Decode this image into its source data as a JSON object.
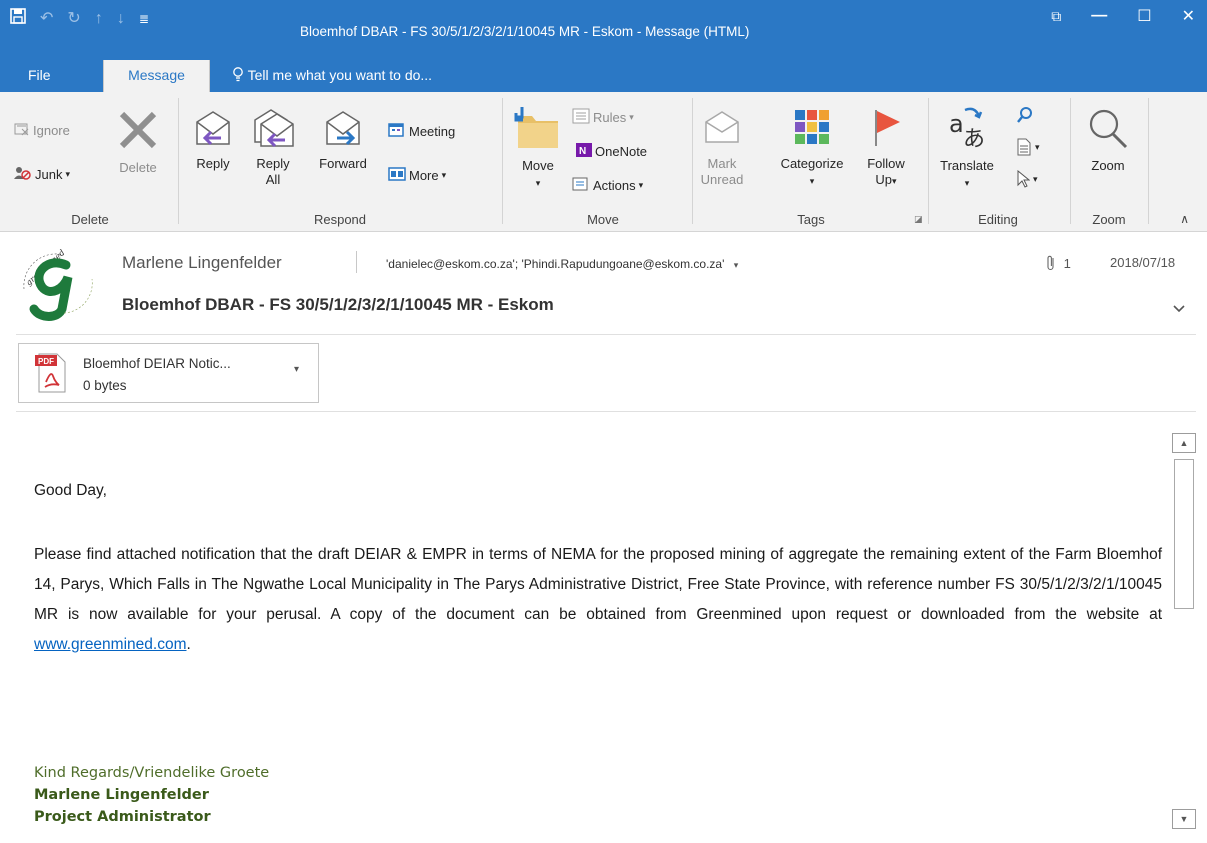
{
  "window": {
    "title": "Bloemhof DBAR - FS 30/5/1/2/3/2/1/10045 MR - Eskom - Message (HTML)",
    "minimize": "—",
    "maximize": "☐",
    "close": "✕",
    "restore_ribbon": "⧉"
  },
  "qat": {
    "save": "💾",
    "undo": "↶",
    "redo": "↻",
    "up": "↑",
    "down": "↓",
    "more": "≣"
  },
  "tabs": {
    "file": "File",
    "message": "Message",
    "tell_me": "Tell me what you want to do..."
  },
  "ribbon": {
    "delete_group": {
      "ignore": "Ignore",
      "junk": "Junk",
      "delete": "Delete",
      "label": "Delete"
    },
    "respond_group": {
      "reply": "Reply",
      "reply_all_1": "Reply",
      "reply_all_2": "All",
      "forward": "Forward",
      "meeting": "Meeting",
      "more": "More",
      "label": "Respond"
    },
    "move_group": {
      "move": "Move",
      "rules": "Rules",
      "onenote": "OneNote",
      "actions": "Actions",
      "label": "Move"
    },
    "tags_group": {
      "mark_1": "Mark",
      "mark_2": "Unread",
      "categorize": "Categorize",
      "follow_1": "Follow",
      "follow_2": "Up",
      "label": "Tags"
    },
    "editing_group": {
      "translate": "Translate",
      "label": "Editing"
    },
    "zoom_group": {
      "zoom": "Zoom",
      "label": "Zoom"
    },
    "colors": {
      "accent": "#2b78c5",
      "purple": "#7e57c2",
      "blue": "#2b78c5",
      "flag": "#e8553f"
    }
  },
  "message": {
    "sender": "Marlene Lingenfelder",
    "recipients": "'danielec@eskom.co.za'; 'Phindi.Rapudungoane@eskom.co.za'",
    "attachment_count": "1",
    "date": "2018/07/18",
    "subject": "Bloemhof DBAR - FS 30/5/1/2/3/2/1/10045 MR - Eskom",
    "logo_text": "greenmined"
  },
  "attachment": {
    "name": "Bloemhof DEIAR Notic...",
    "size": "0 bytes",
    "badge": "PDF"
  },
  "body": {
    "greeting": "Good Day,",
    "paragraph_before_link": "Please find attached notification that the draft DEIAR & EMPR in terms of NEMA for the proposed mining of aggregate the remaining extent of the Farm Bloemhof 14, Parys, Which Falls in The Ngwathe Local Municipality in The Parys Administrative District, Free State Province, with reference number FS 30/5/1/2/3/2/1/10045 MR is now available for your perusal.  A copy of the document can be obtained from Greenmined upon request or downloaded from the website at ",
    "link": "www.greenmined.com",
    "paragraph_after_link": ".",
    "sig_regards": "Kind Regards/Vriendelike Groete",
    "sig_name": "Marlene Lingenfelder",
    "sig_title": "Project Administrator"
  }
}
